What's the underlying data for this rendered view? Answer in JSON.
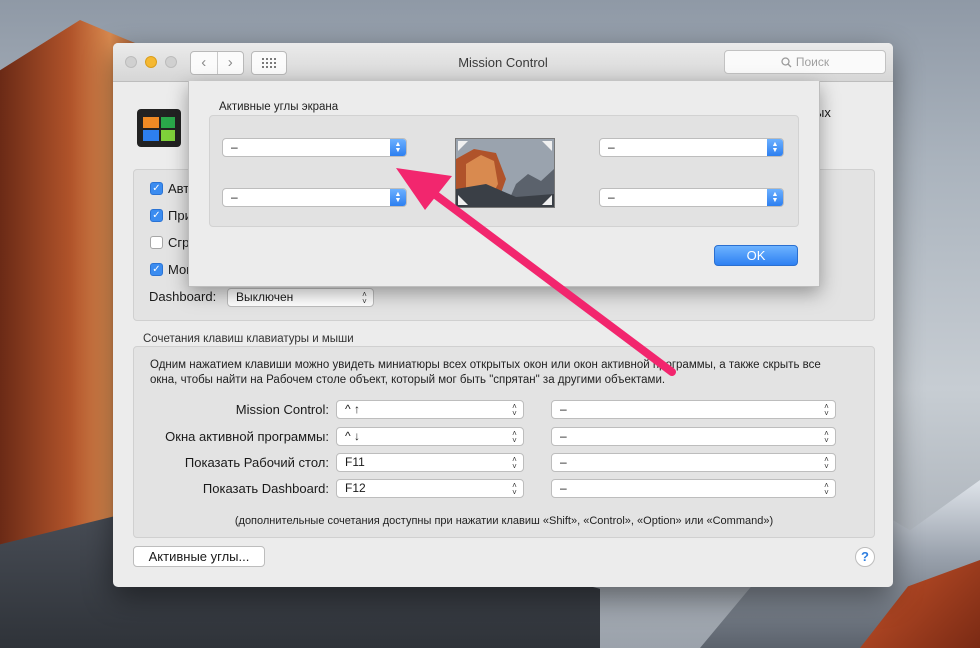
{
  "window": {
    "title": "Mission Control",
    "search_placeholder": "Поиск",
    "header_partial_text": "ых"
  },
  "settings": {
    "checkboxes": [
      {
        "label": "Авт",
        "checked": true
      },
      {
        "label": "При",
        "checked": true
      },
      {
        "label": "Сгр",
        "checked": false
      },
      {
        "label": "Мон",
        "checked": true
      }
    ],
    "dashboard_label": "Dashboard:",
    "dashboard_value": "Выключен"
  },
  "shortcuts": {
    "section_title": "Сочетания клавиш клавиатуры и мыши",
    "description": "Одним нажатием клавиши можно увидеть миниатюры всех открытых окон или окон активной программы, а также скрыть все окна, чтобы найти на Рабочем столе объект, который мог быть \"спрятан\" за другими объектами.",
    "rows": [
      {
        "label": "Mission Control:",
        "key": "^ ↑",
        "mouse": "–"
      },
      {
        "label": "Окна активной программы:",
        "key": "^ ↓",
        "mouse": "–"
      },
      {
        "label": "Показать Рабочий стол:",
        "key": "F11",
        "mouse": "–"
      },
      {
        "label": "Показать Dashboard:",
        "key": "F12",
        "mouse": "–"
      }
    ],
    "footnote": "(дополнительные сочетания доступны при нажатии клавиш «Shift», «Control», «Option» или «Command»)"
  },
  "buttons": {
    "hot_corners": "Активные углы...",
    "help": "?"
  },
  "sheet": {
    "title": "Активные углы экрана",
    "corners": {
      "top_left": "–",
      "bottom_left": "–",
      "top_right": "–",
      "bottom_right": "–"
    },
    "ok_label": "OK"
  },
  "colors": {
    "accent_blue": "#2e80f2",
    "arrow_pink": "#f2266e",
    "minimize_yellow": "#f5b832"
  }
}
